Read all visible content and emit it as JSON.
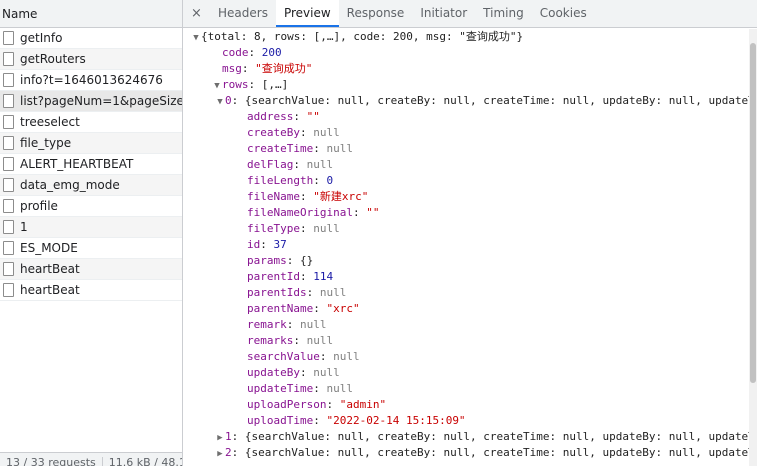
{
  "requests": {
    "header": "Name",
    "items": [
      {
        "name": "getInfo"
      },
      {
        "name": "getRouters"
      },
      {
        "name": "info?t=1646013624676"
      },
      {
        "name": "list?pageNum=1&pageSize...",
        "selected": true
      },
      {
        "name": "treeselect"
      },
      {
        "name": "file_type"
      },
      {
        "name": "ALERT_HEARTBEAT"
      },
      {
        "name": "data_emg_mode"
      },
      {
        "name": "profile"
      },
      {
        "name": "1"
      },
      {
        "name": "ES_MODE"
      },
      {
        "name": "heartBeat"
      },
      {
        "name": "heartBeat"
      }
    ],
    "footer": {
      "count": "13 / 33 requests",
      "size": "11.6 kB / 48.1"
    }
  },
  "detail": {
    "close": "×",
    "tabs": [
      {
        "label": "Headers"
      },
      {
        "label": "Preview",
        "active": true
      },
      {
        "label": "Response"
      },
      {
        "label": "Initiator"
      },
      {
        "label": "Timing"
      },
      {
        "label": "Cookies"
      }
    ]
  },
  "preview": {
    "lines": [
      {
        "indent": 0,
        "arrow": "down",
        "segments": [
          {
            "t": "{total: 8, rows: [,…], code: 200, msg: \"查询成功\"}",
            "c": "p"
          }
        ]
      },
      {
        "indent": 1,
        "segments": [
          {
            "t": "code",
            "c": "k"
          },
          {
            "t": ": ",
            "c": "p"
          },
          {
            "t": "200",
            "c": "n"
          }
        ]
      },
      {
        "indent": 1,
        "segments": [
          {
            "t": "msg",
            "c": "k"
          },
          {
            "t": ": ",
            "c": "p"
          },
          {
            "t": "\"查询成功\"",
            "c": "s"
          }
        ]
      },
      {
        "indent": 1,
        "arrow": "down",
        "segments": [
          {
            "t": "rows",
            "c": "k"
          },
          {
            "t": ": [,…]",
            "c": "p"
          }
        ]
      },
      {
        "indent": 2,
        "arrow": "down",
        "segments": [
          {
            "t": "0",
            "c": "k"
          },
          {
            "t": ": {searchValue: null, createBy: null, createTime: null, updateBy: null, updateT",
            "c": "p"
          }
        ]
      },
      {
        "indent": 3,
        "segments": [
          {
            "t": "address",
            "c": "k"
          },
          {
            "t": ": ",
            "c": "p"
          },
          {
            "t": "\"\"",
            "c": "s"
          }
        ]
      },
      {
        "indent": 3,
        "segments": [
          {
            "t": "createBy",
            "c": "k"
          },
          {
            "t": ": ",
            "c": "p"
          },
          {
            "t": "null",
            "c": "nl"
          }
        ]
      },
      {
        "indent": 3,
        "segments": [
          {
            "t": "createTime",
            "c": "k"
          },
          {
            "t": ": ",
            "c": "p"
          },
          {
            "t": "null",
            "c": "nl"
          }
        ]
      },
      {
        "indent": 3,
        "segments": [
          {
            "t": "delFlag",
            "c": "k"
          },
          {
            "t": ": ",
            "c": "p"
          },
          {
            "t": "null",
            "c": "nl"
          }
        ]
      },
      {
        "indent": 3,
        "segments": [
          {
            "t": "fileLength",
            "c": "k"
          },
          {
            "t": ": ",
            "c": "p"
          },
          {
            "t": "0",
            "c": "n"
          }
        ]
      },
      {
        "indent": 3,
        "segments": [
          {
            "t": "fileName",
            "c": "k"
          },
          {
            "t": ": ",
            "c": "p"
          },
          {
            "t": "\"新建xrc\"",
            "c": "s"
          }
        ]
      },
      {
        "indent": 3,
        "segments": [
          {
            "t": "fileNameOriginal",
            "c": "k"
          },
          {
            "t": ": ",
            "c": "p"
          },
          {
            "t": "\"\"",
            "c": "s"
          }
        ]
      },
      {
        "indent": 3,
        "segments": [
          {
            "t": "fileType",
            "c": "k"
          },
          {
            "t": ": ",
            "c": "p"
          },
          {
            "t": "null",
            "c": "nl"
          }
        ]
      },
      {
        "indent": 3,
        "segments": [
          {
            "t": "id",
            "c": "k"
          },
          {
            "t": ": ",
            "c": "p"
          },
          {
            "t": "37",
            "c": "n"
          }
        ]
      },
      {
        "indent": 3,
        "segments": [
          {
            "t": "params",
            "c": "k"
          },
          {
            "t": ": {}",
            "c": "p"
          }
        ]
      },
      {
        "indent": 3,
        "segments": [
          {
            "t": "parentId",
            "c": "k"
          },
          {
            "t": ": ",
            "c": "p"
          },
          {
            "t": "114",
            "c": "n"
          }
        ]
      },
      {
        "indent": 3,
        "segments": [
          {
            "t": "parentIds",
            "c": "k"
          },
          {
            "t": ": ",
            "c": "p"
          },
          {
            "t": "null",
            "c": "nl"
          }
        ]
      },
      {
        "indent": 3,
        "segments": [
          {
            "t": "parentName",
            "c": "k"
          },
          {
            "t": ": ",
            "c": "p"
          },
          {
            "t": "\"xrc\"",
            "c": "s"
          }
        ]
      },
      {
        "indent": 3,
        "segments": [
          {
            "t": "remark",
            "c": "k"
          },
          {
            "t": ": ",
            "c": "p"
          },
          {
            "t": "null",
            "c": "nl"
          }
        ]
      },
      {
        "indent": 3,
        "segments": [
          {
            "t": "remarks",
            "c": "k"
          },
          {
            "t": ": ",
            "c": "p"
          },
          {
            "t": "null",
            "c": "nl"
          }
        ]
      },
      {
        "indent": 3,
        "segments": [
          {
            "t": "searchValue",
            "c": "k"
          },
          {
            "t": ": ",
            "c": "p"
          },
          {
            "t": "null",
            "c": "nl"
          }
        ]
      },
      {
        "indent": 3,
        "segments": [
          {
            "t": "updateBy",
            "c": "k"
          },
          {
            "t": ": ",
            "c": "p"
          },
          {
            "t": "null",
            "c": "nl"
          }
        ]
      },
      {
        "indent": 3,
        "segments": [
          {
            "t": "updateTime",
            "c": "k"
          },
          {
            "t": ": ",
            "c": "p"
          },
          {
            "t": "null",
            "c": "nl"
          }
        ]
      },
      {
        "indent": 3,
        "segments": [
          {
            "t": "uploadPerson",
            "c": "k"
          },
          {
            "t": ": ",
            "c": "p"
          },
          {
            "t": "\"admin\"",
            "c": "s"
          }
        ]
      },
      {
        "indent": 3,
        "segments": [
          {
            "t": "uploadTime",
            "c": "k"
          },
          {
            "t": ": ",
            "c": "p"
          },
          {
            "t": "\"2022-02-14 15:15:09\"",
            "c": "s"
          }
        ]
      },
      {
        "indent": 2,
        "arrow": "right",
        "segments": [
          {
            "t": "1",
            "c": "k"
          },
          {
            "t": ": {searchValue: null, createBy: null, createTime: null, updateBy: null, updateT",
            "c": "p"
          }
        ]
      },
      {
        "indent": 2,
        "arrow": "right",
        "segments": [
          {
            "t": "2",
            "c": "k"
          },
          {
            "t": ": {searchValue: null, createBy: null, createTime: null, updateBy: null, updateT",
            "c": "p"
          }
        ]
      }
    ]
  }
}
